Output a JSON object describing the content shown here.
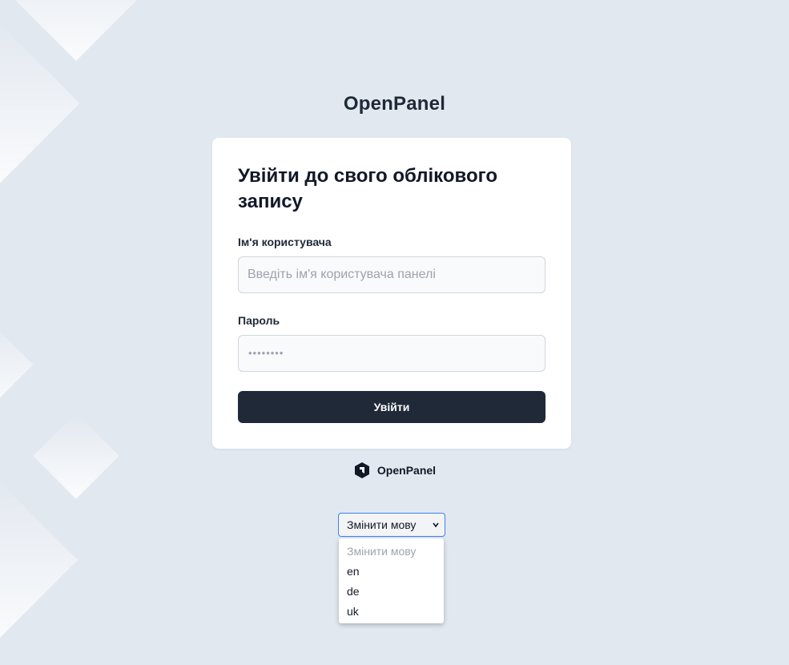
{
  "app": {
    "title": "OpenPanel"
  },
  "login": {
    "heading": "Увійти до свого облікового запису",
    "username_label": "Ім'я користувача",
    "username_placeholder": "Введіть ім'я користувача панелі",
    "username_value": "",
    "password_label": "Пароль",
    "password_placeholder": "••••••••",
    "submit_label": "Увійти"
  },
  "footer": {
    "brand_name": "OpenPanel",
    "logo_icon": "openpanel-logo-icon"
  },
  "language": {
    "selected": "Змінити мову",
    "options": [
      "Змінити мову",
      "en",
      "de",
      "uk"
    ]
  },
  "colors": {
    "background": "#e2e8f0",
    "button": "#1f2937",
    "focus_border": "#3b82f6"
  }
}
